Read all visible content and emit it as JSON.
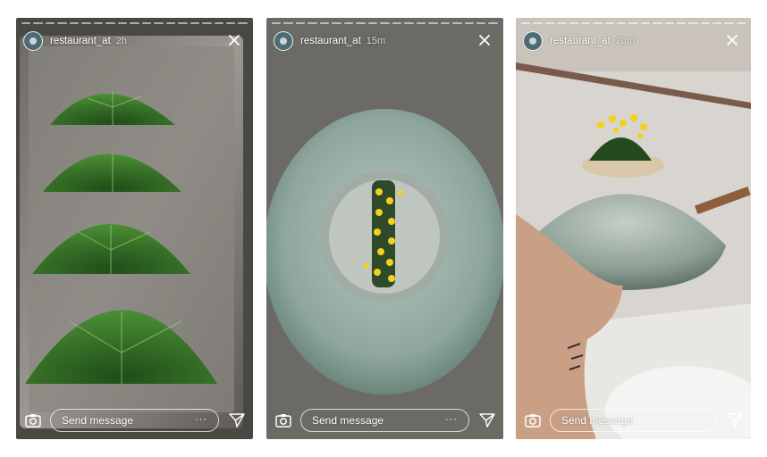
{
  "stories": [
    {
      "username": "restaurant_at",
      "time": "2h",
      "message_placeholder": "Send message",
      "more_label": "···",
      "segments": 19
    },
    {
      "username": "restaurant_at",
      "time": "15m",
      "message_placeholder": "Send message",
      "more_label": "···",
      "segments": 19
    },
    {
      "username": "restaurant_at",
      "time": "20m",
      "message_placeholder": "Send message",
      "more_label": "···",
      "segments": 19
    }
  ],
  "icons": {
    "avatar": "profile-avatar",
    "close": "close-icon",
    "camera": "camera-icon",
    "send": "paper-plane-icon"
  },
  "colors": {
    "text": "#ffffff",
    "leaf": "#3f7a2c",
    "bowl": "#8fa8a2",
    "flower": "#f2d21b"
  }
}
